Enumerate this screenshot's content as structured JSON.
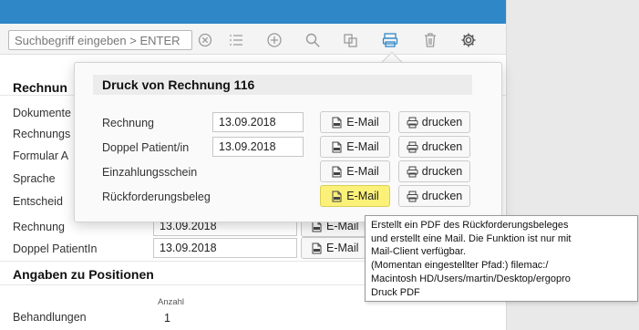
{
  "toolbar": {
    "search_placeholder": "Suchbegriff eingeben > ENTER"
  },
  "background": {
    "section1_title": "Rechnun",
    "labels": [
      "Dokumente",
      "Rechnungs",
      "Formular A",
      "Sprache",
      "Entscheid"
    ],
    "row_rechnung_label": "Rechnung",
    "row_rechnung_date": "13.09.2018",
    "row_doppel_label": "Doppel PatientIn",
    "row_doppel_date": "13.09.2018",
    "email_label": "E-Mail",
    "section2_title": "Angaben zu Positionen",
    "anzahl_label": "Anzahl",
    "behandlungen_label": "Behandlungen",
    "behandlungen_value": "1"
  },
  "popover": {
    "title": "Druck von Rechnung 116",
    "rows": [
      {
        "label": "Rechnung",
        "date": "13.09.2018",
        "email": "E-Mail",
        "print": "drucken"
      },
      {
        "label": "Doppel Patient/in",
        "date": "13.09.2018",
        "email": "E-Mail",
        "print": "drucken"
      },
      {
        "label": "Einzahlungsschein",
        "date": "",
        "email": "E-Mail",
        "print": "drucken"
      },
      {
        "label": "Rückforderungsbeleg",
        "date": "",
        "email": "E-Mail",
        "print": "drucken"
      }
    ]
  },
  "tooltip": {
    "text": "Erstellt ein PDF des Rückforderungsbeleges\nund erstellt eine Mail. Die Funktion ist nur mit\nMail-Client verfügbar.\n(Momentan eingestellter Pfad:) filemac:/\nMacintosh HD/Users/martin/Desktop/ergopro\nDruck PDF"
  },
  "colors": {
    "topbar": "#2f87c8",
    "highlight": "#fbf179",
    "active_icon": "#2f87c8"
  },
  "icons": [
    "clear-icon",
    "list-icon",
    "add-icon",
    "search-icon",
    "duplicate-icon",
    "print-icon",
    "trash-icon",
    "gear-icon",
    "pdf-icon",
    "printer-icon"
  ]
}
